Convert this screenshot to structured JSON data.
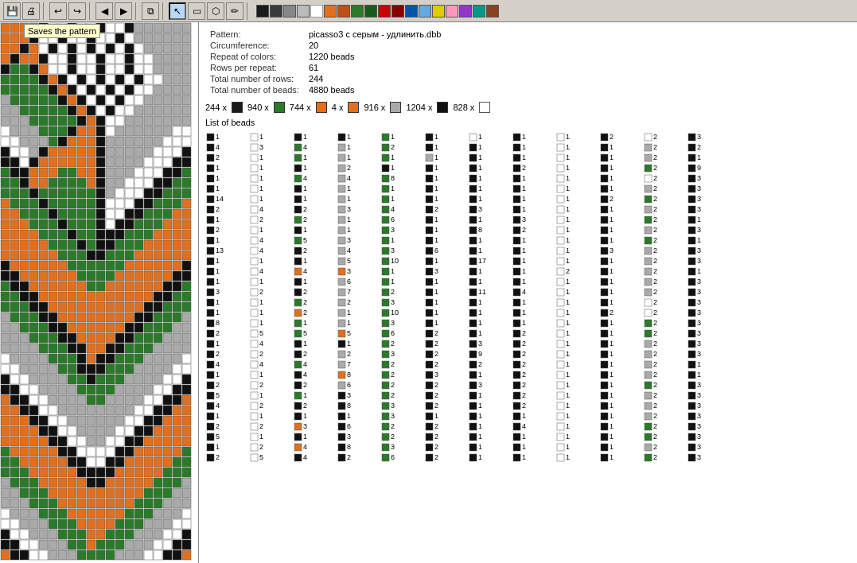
{
  "toolbar": {
    "tooltip": "Saves the pattern",
    "buttons": [
      {
        "name": "save",
        "icon": "💾",
        "label": "Save"
      },
      {
        "name": "print",
        "icon": "🖨",
        "label": "Print"
      },
      {
        "name": "undo",
        "icon": "↩",
        "label": "Undo"
      },
      {
        "name": "redo",
        "icon": "↪",
        "label": "Redo"
      },
      {
        "name": "prev",
        "icon": "◀",
        "label": "Previous"
      },
      {
        "name": "next",
        "icon": "▶",
        "label": "Next"
      },
      {
        "name": "copy",
        "icon": "⧉",
        "label": "Copy"
      },
      {
        "name": "select",
        "icon": "↖",
        "label": "Select"
      },
      {
        "name": "rect",
        "icon": "▭",
        "label": "Rectangle"
      },
      {
        "name": "fill",
        "icon": "⬡",
        "label": "Fill"
      },
      {
        "name": "pen",
        "icon": "✏",
        "label": "Pen"
      }
    ],
    "colors": [
      "#3d3d3d",
      "#1a1a1a",
      "#333",
      "#555",
      "#888",
      "#aaa",
      "#ccc",
      "#eee",
      "#fff",
      "#e07020",
      "#d4601a",
      "#228b22",
      "#2d8b2d",
      "#ff6600",
      "#ffaa00",
      "#ffdd00",
      "#cc3300",
      "#aa0000",
      "#660000",
      "#003366",
      "#0055aa",
      "#0088cc",
      "#33aadd",
      "#66ccee",
      "#99ddff",
      "#cc99ff",
      "#9933cc",
      "#ff99cc",
      "#ff66aa",
      "#ffccdd"
    ]
  },
  "pattern": {
    "filename": "picasso3 с серым - удлинить.dbb",
    "circumference": "20",
    "repeat_of_colors": "1220 beads",
    "rows_per_repeat": "61",
    "total_rows": "244",
    "total_beads": "4880 beads",
    "labels": {
      "pattern": "Pattern:",
      "circumference": "Circumference:",
      "repeat": "Repeat of colors:",
      "rows_per_repeat": "Rows per repeat:",
      "total_rows": "Total number of rows:",
      "total_beads": "Total number of beads:"
    }
  },
  "color_counts": [
    {
      "count": "244",
      "color": "#1a1a1a"
    },
    {
      "count": "940",
      "color": "#2a7a2a"
    },
    {
      "count": "744",
      "color": "#e07020"
    },
    {
      "count": "4",
      "color": "#e07020"
    },
    {
      "count": "916",
      "color": "#cccccc"
    },
    {
      "count": "1204",
      "color": "#111111"
    },
    {
      "count": "828",
      "color": "#ffffff"
    }
  ],
  "list_header": "List of beads"
}
